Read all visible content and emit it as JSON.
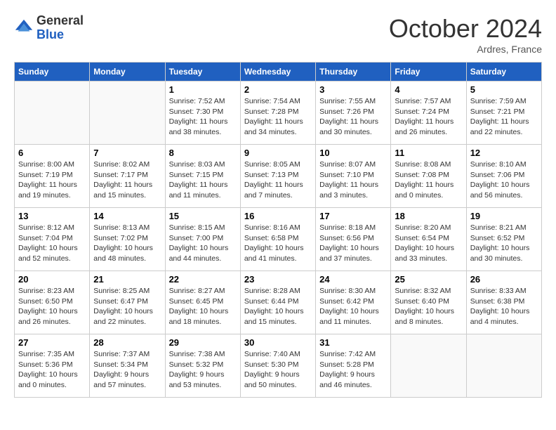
{
  "header": {
    "logo_line1": "General",
    "logo_line2": "Blue",
    "month": "October 2024",
    "location": "Ardres, France"
  },
  "days_of_week": [
    "Sunday",
    "Monday",
    "Tuesday",
    "Wednesday",
    "Thursday",
    "Friday",
    "Saturday"
  ],
  "weeks": [
    [
      {
        "day": "",
        "sunrise": "",
        "sunset": "",
        "daylight": ""
      },
      {
        "day": "",
        "sunrise": "",
        "sunset": "",
        "daylight": ""
      },
      {
        "day": "1",
        "sunrise": "Sunrise: 7:52 AM",
        "sunset": "Sunset: 7:30 PM",
        "daylight": "Daylight: 11 hours and 38 minutes."
      },
      {
        "day": "2",
        "sunrise": "Sunrise: 7:54 AM",
        "sunset": "Sunset: 7:28 PM",
        "daylight": "Daylight: 11 hours and 34 minutes."
      },
      {
        "day": "3",
        "sunrise": "Sunrise: 7:55 AM",
        "sunset": "Sunset: 7:26 PM",
        "daylight": "Daylight: 11 hours and 30 minutes."
      },
      {
        "day": "4",
        "sunrise": "Sunrise: 7:57 AM",
        "sunset": "Sunset: 7:24 PM",
        "daylight": "Daylight: 11 hours and 26 minutes."
      },
      {
        "day": "5",
        "sunrise": "Sunrise: 7:59 AM",
        "sunset": "Sunset: 7:21 PM",
        "daylight": "Daylight: 11 hours and 22 minutes."
      }
    ],
    [
      {
        "day": "6",
        "sunrise": "Sunrise: 8:00 AM",
        "sunset": "Sunset: 7:19 PM",
        "daylight": "Daylight: 11 hours and 19 minutes."
      },
      {
        "day": "7",
        "sunrise": "Sunrise: 8:02 AM",
        "sunset": "Sunset: 7:17 PM",
        "daylight": "Daylight: 11 hours and 15 minutes."
      },
      {
        "day": "8",
        "sunrise": "Sunrise: 8:03 AM",
        "sunset": "Sunset: 7:15 PM",
        "daylight": "Daylight: 11 hours and 11 minutes."
      },
      {
        "day": "9",
        "sunrise": "Sunrise: 8:05 AM",
        "sunset": "Sunset: 7:13 PM",
        "daylight": "Daylight: 11 hours and 7 minutes."
      },
      {
        "day": "10",
        "sunrise": "Sunrise: 8:07 AM",
        "sunset": "Sunset: 7:10 PM",
        "daylight": "Daylight: 11 hours and 3 minutes."
      },
      {
        "day": "11",
        "sunrise": "Sunrise: 8:08 AM",
        "sunset": "Sunset: 7:08 PM",
        "daylight": "Daylight: 11 hours and 0 minutes."
      },
      {
        "day": "12",
        "sunrise": "Sunrise: 8:10 AM",
        "sunset": "Sunset: 7:06 PM",
        "daylight": "Daylight: 10 hours and 56 minutes."
      }
    ],
    [
      {
        "day": "13",
        "sunrise": "Sunrise: 8:12 AM",
        "sunset": "Sunset: 7:04 PM",
        "daylight": "Daylight: 10 hours and 52 minutes."
      },
      {
        "day": "14",
        "sunrise": "Sunrise: 8:13 AM",
        "sunset": "Sunset: 7:02 PM",
        "daylight": "Daylight: 10 hours and 48 minutes."
      },
      {
        "day": "15",
        "sunrise": "Sunrise: 8:15 AM",
        "sunset": "Sunset: 7:00 PM",
        "daylight": "Daylight: 10 hours and 44 minutes."
      },
      {
        "day": "16",
        "sunrise": "Sunrise: 8:16 AM",
        "sunset": "Sunset: 6:58 PM",
        "daylight": "Daylight: 10 hours and 41 minutes."
      },
      {
        "day": "17",
        "sunrise": "Sunrise: 8:18 AM",
        "sunset": "Sunset: 6:56 PM",
        "daylight": "Daylight: 10 hours and 37 minutes."
      },
      {
        "day": "18",
        "sunrise": "Sunrise: 8:20 AM",
        "sunset": "Sunset: 6:54 PM",
        "daylight": "Daylight: 10 hours and 33 minutes."
      },
      {
        "day": "19",
        "sunrise": "Sunrise: 8:21 AM",
        "sunset": "Sunset: 6:52 PM",
        "daylight": "Daylight: 10 hours and 30 minutes."
      }
    ],
    [
      {
        "day": "20",
        "sunrise": "Sunrise: 8:23 AM",
        "sunset": "Sunset: 6:50 PM",
        "daylight": "Daylight: 10 hours and 26 minutes."
      },
      {
        "day": "21",
        "sunrise": "Sunrise: 8:25 AM",
        "sunset": "Sunset: 6:47 PM",
        "daylight": "Daylight: 10 hours and 22 minutes."
      },
      {
        "day": "22",
        "sunrise": "Sunrise: 8:27 AM",
        "sunset": "Sunset: 6:45 PM",
        "daylight": "Daylight: 10 hours and 18 minutes."
      },
      {
        "day": "23",
        "sunrise": "Sunrise: 8:28 AM",
        "sunset": "Sunset: 6:44 PM",
        "daylight": "Daylight: 10 hours and 15 minutes."
      },
      {
        "day": "24",
        "sunrise": "Sunrise: 8:30 AM",
        "sunset": "Sunset: 6:42 PM",
        "daylight": "Daylight: 10 hours and 11 minutes."
      },
      {
        "day": "25",
        "sunrise": "Sunrise: 8:32 AM",
        "sunset": "Sunset: 6:40 PM",
        "daylight": "Daylight: 10 hours and 8 minutes."
      },
      {
        "day": "26",
        "sunrise": "Sunrise: 8:33 AM",
        "sunset": "Sunset: 6:38 PM",
        "daylight": "Daylight: 10 hours and 4 minutes."
      }
    ],
    [
      {
        "day": "27",
        "sunrise": "Sunrise: 7:35 AM",
        "sunset": "Sunset: 5:36 PM",
        "daylight": "Daylight: 10 hours and 0 minutes."
      },
      {
        "day": "28",
        "sunrise": "Sunrise: 7:37 AM",
        "sunset": "Sunset: 5:34 PM",
        "daylight": "Daylight: 9 hours and 57 minutes."
      },
      {
        "day": "29",
        "sunrise": "Sunrise: 7:38 AM",
        "sunset": "Sunset: 5:32 PM",
        "daylight": "Daylight: 9 hours and 53 minutes."
      },
      {
        "day": "30",
        "sunrise": "Sunrise: 7:40 AM",
        "sunset": "Sunset: 5:30 PM",
        "daylight": "Daylight: 9 hours and 50 minutes."
      },
      {
        "day": "31",
        "sunrise": "Sunrise: 7:42 AM",
        "sunset": "Sunset: 5:28 PM",
        "daylight": "Daylight: 9 hours and 46 minutes."
      },
      {
        "day": "",
        "sunrise": "",
        "sunset": "",
        "daylight": ""
      },
      {
        "day": "",
        "sunrise": "",
        "sunset": "",
        "daylight": ""
      }
    ]
  ]
}
